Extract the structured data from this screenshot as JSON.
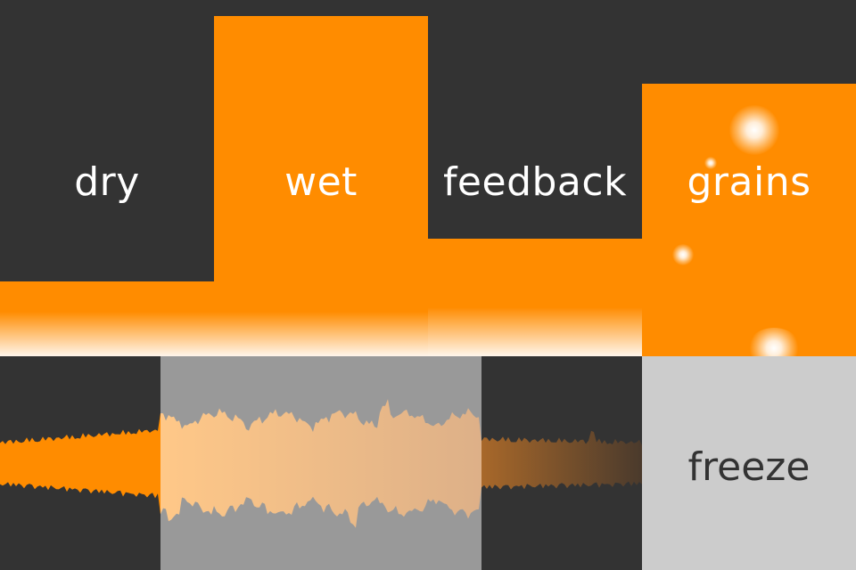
{
  "colors": {
    "background": "#333333",
    "accent": "#FF8C00",
    "selection": "#999999",
    "freeze_background": "#CCCCCC",
    "label_light": "#FFFFFF",
    "label_dark": "#333333"
  },
  "sliders": [
    {
      "id": "dry",
      "label": "dry",
      "level": 0.21
    },
    {
      "id": "wet",
      "label": "wet",
      "level": 0.955
    },
    {
      "id": "feedback",
      "label": "feedback",
      "level": 0.33
    },
    {
      "id": "grains",
      "label": "grains",
      "level": 0.765
    }
  ],
  "waveform": {
    "selection_start": 0.25,
    "selection_end": 0.75
  },
  "freeze": {
    "label": "freeze"
  }
}
